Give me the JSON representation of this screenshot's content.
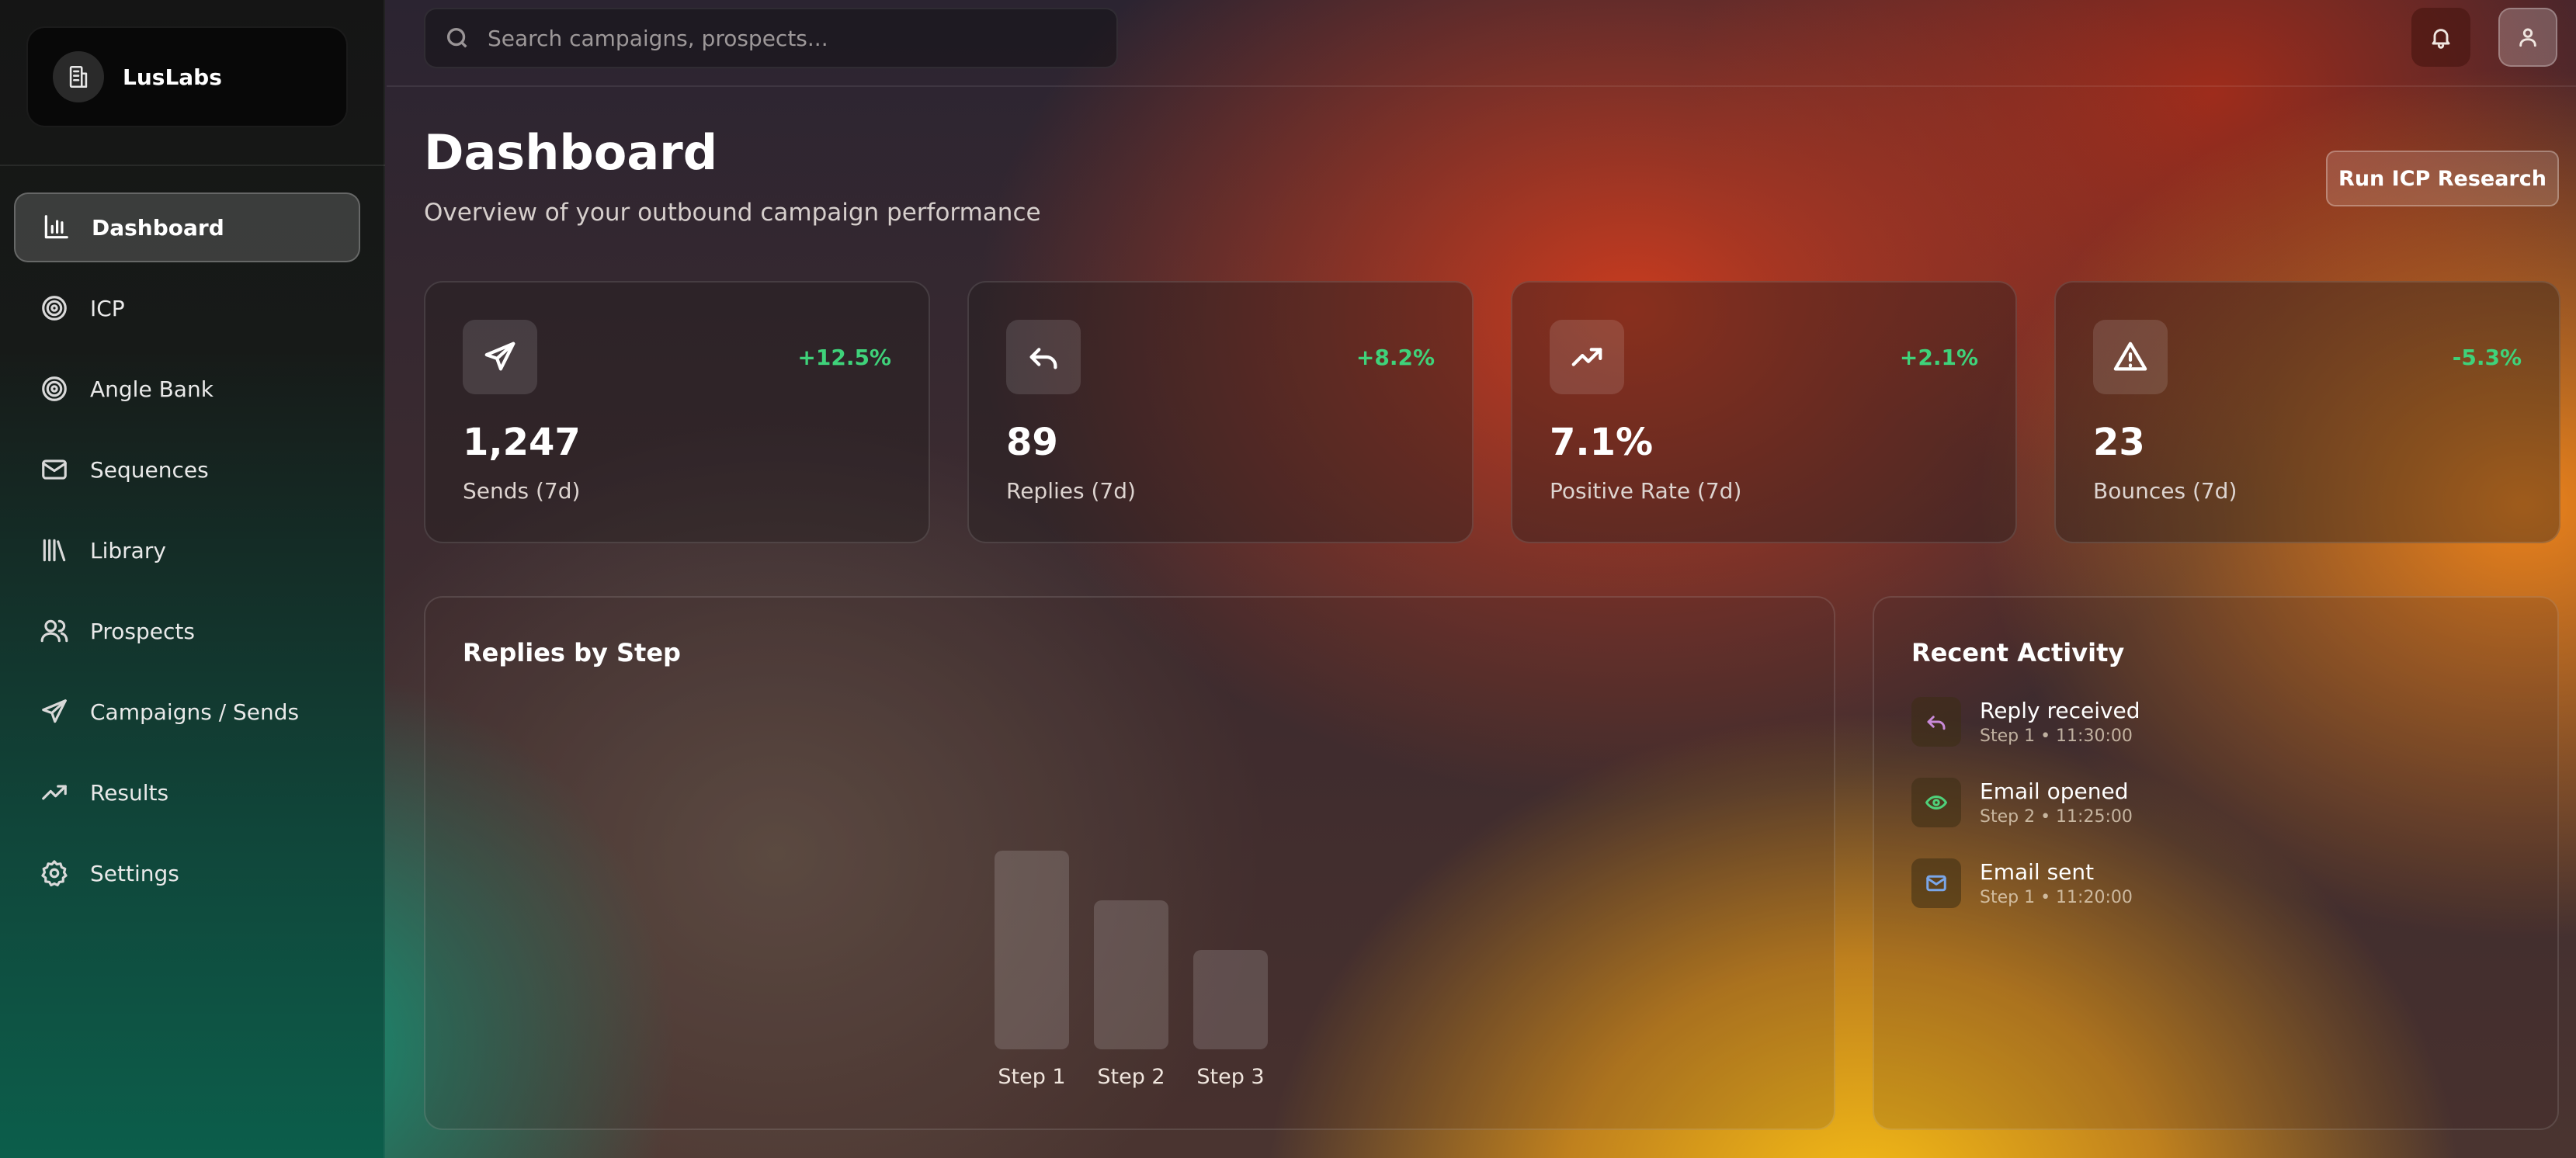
{
  "app": {
    "name": "LusLabs",
    "brand_icon": "building-icon"
  },
  "sidebar": {
    "items": [
      {
        "label": "Dashboard",
        "icon": "bar-chart-icon",
        "active": true
      },
      {
        "label": "ICP",
        "icon": "target-icon",
        "active": false
      },
      {
        "label": "Angle Bank",
        "icon": "target-icon",
        "active": false
      },
      {
        "label": "Sequences",
        "icon": "mail-icon",
        "active": false
      },
      {
        "label": "Library",
        "icon": "library-icon",
        "active": false
      },
      {
        "label": "Prospects",
        "icon": "users-icon",
        "active": false
      },
      {
        "label": "Campaigns / Sends",
        "icon": "send-icon",
        "active": false
      },
      {
        "label": "Results",
        "icon": "trending-up-icon",
        "active": false
      },
      {
        "label": "Settings",
        "icon": "gear-icon",
        "active": false
      }
    ]
  },
  "topbar": {
    "search_placeholder": "Search campaigns, prospects...",
    "bell_icon": "bell-icon",
    "user_icon": "user-icon"
  },
  "header": {
    "title": "Dashboard",
    "subtitle": "Overview of your outbound campaign performance",
    "action_label": "Run ICP Research"
  },
  "stats": [
    {
      "value": "1,247",
      "label": "Sends (7d)",
      "delta": "+12.5%",
      "icon": "send-icon",
      "delta_color": "#3fd27a"
    },
    {
      "value": "89",
      "label": "Replies (7d)",
      "delta": "+8.2%",
      "icon": "reply-icon",
      "delta_color": "#3fd27a"
    },
    {
      "value": "7.1%",
      "label": "Positive Rate (7d)",
      "delta": "+2.1%",
      "icon": "trending-up-icon",
      "delta_color": "#3fd27a"
    },
    {
      "value": "23",
      "label": "Bounces (7d)",
      "delta": "-5.3%",
      "icon": "alert-triangle-icon",
      "delta_color": "#3fd27a"
    }
  ],
  "replies_chart": {
    "title": "Replies by Step"
  },
  "chart_data": {
    "type": "bar",
    "title": "Replies by Step",
    "categories": [
      "Step 1",
      "Step 2",
      "Step 3"
    ],
    "values": [
      40,
      30,
      20
    ],
    "ylim": [
      0,
      40
    ],
    "xlabel": "",
    "ylabel": "",
    "grid": false
  },
  "activity": {
    "title": "Recent Activity",
    "items": [
      {
        "title": "Reply received",
        "meta": "Step 1 • 11:30:00",
        "icon": "reply-icon",
        "color": "#c98ad8"
      },
      {
        "title": "Email opened",
        "meta": "Step 2 • 11:25:00",
        "icon": "eye-icon",
        "color": "#4fd07a"
      },
      {
        "title": "Email sent",
        "meta": "Step 1 • 11:20:00",
        "icon": "mail-icon",
        "color": "#7aa6e8"
      }
    ]
  }
}
